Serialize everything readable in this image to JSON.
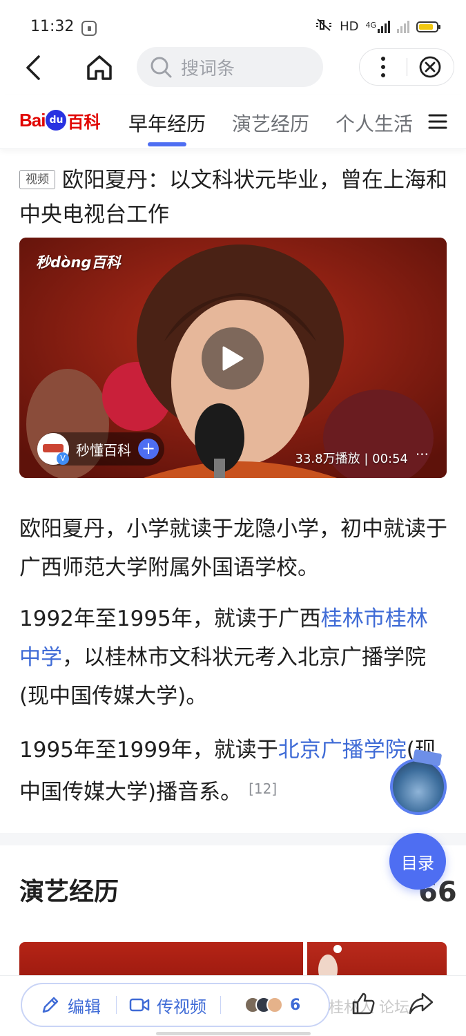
{
  "status_bar": {
    "time": "11:32",
    "network": "HD",
    "network_type": "4G"
  },
  "nav": {
    "search_placeholder": "搜词条"
  },
  "brand": {
    "logo_text_latin": "Bai",
    "logo_paw_text": "du",
    "logo_text_cn": "百科",
    "logo_color": "#e10602",
    "accent_color": "#4e6ef2"
  },
  "tabs": [
    {
      "label": "早年经历",
      "active": true
    },
    {
      "label": "演艺经历",
      "active": false
    },
    {
      "label": "个人生活",
      "active": false
    }
  ],
  "video": {
    "tag": "视频",
    "title": "欧阳夏丹：以文科状元毕业，曾在上海和中央电视台工作",
    "watermark": "秒dòng百科",
    "channel": "秒懂百科",
    "follow_symbol": "+",
    "meta": "33.8万播放 | 00:54",
    "more": "···"
  },
  "paragraphs": {
    "p1": "欧阳夏丹，小学就读于龙隐小学，初中就读于广西师范大学附属外国语学校。",
    "p2_before": "1992年至1995年，就读于广西",
    "p2_link": "桂林市桂林中学",
    "p2_after": "，以桂林市文科状元考入北京广播学院(现中国传媒大学)。",
    "p3_before": "1995年至1999年，就读于",
    "p3_link": "北京广播学院",
    "p3_after": "(现中国传媒大学)播音系。",
    "p3_cite": "[12]"
  },
  "section": {
    "title": "演艺经历",
    "quote_mark": "66"
  },
  "floating": {
    "toc_label": "目录"
  },
  "bottom_bar": {
    "edit_label": "编辑",
    "video_label": "传视频",
    "contributor_count": "6",
    "watermark": "桂林人 论坛"
  }
}
